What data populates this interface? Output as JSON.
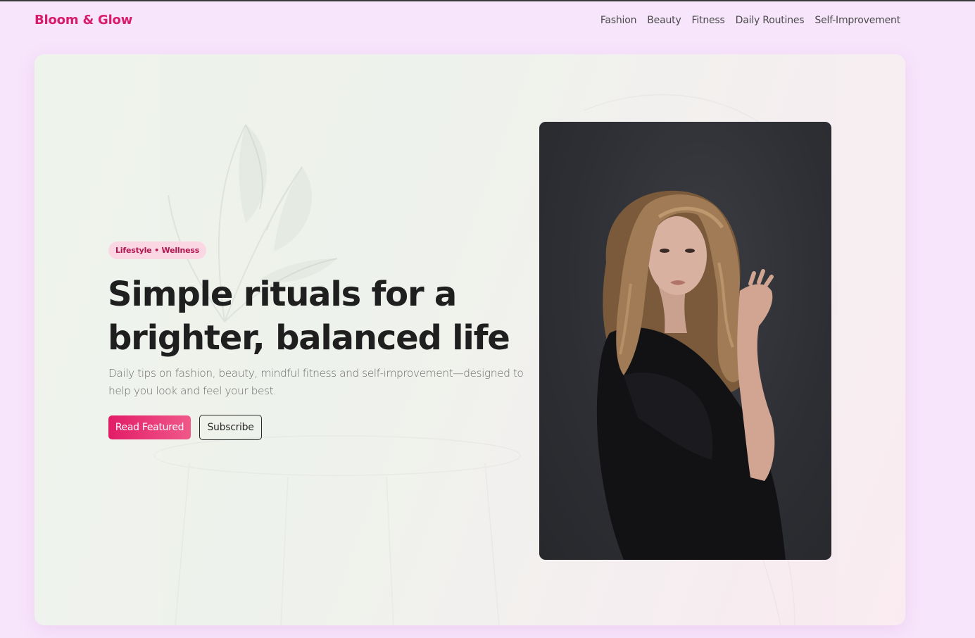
{
  "header": {
    "brand": "Bloom & Glow",
    "nav": [
      "Fashion",
      "Beauty",
      "Fitness",
      "Daily Routines",
      "Self-Improvement"
    ]
  },
  "hero": {
    "tag": "Lifestyle • Wellness",
    "title": "Simple rituals for a brighter, balanced life",
    "subtitle": "Daily tips on fashion, beauty, mindful fitness and self-improvement—designed to help you look and feel your best.",
    "primary_button": "Read Featured",
    "secondary_button": "Subscribe"
  },
  "colors": {
    "accent": "#d81b6a",
    "page_background": "#f7e5fb",
    "tag_background": "#fbd7e4",
    "text_dark": "#1f1f1f"
  }
}
